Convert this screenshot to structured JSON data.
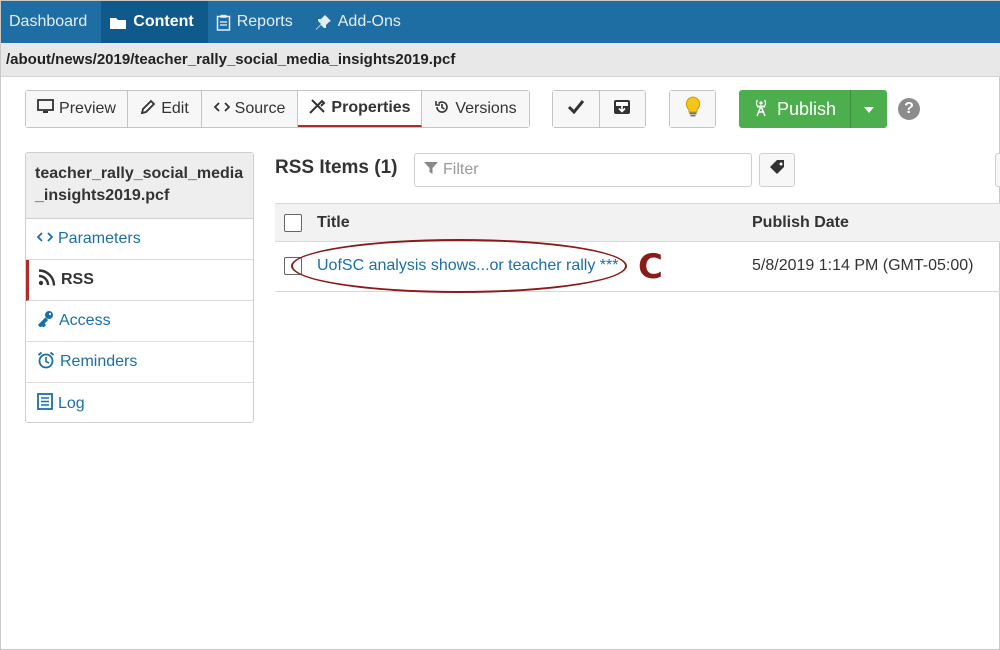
{
  "nav": {
    "items": [
      {
        "label": "Dashboard",
        "icon": ""
      },
      {
        "label": "Content",
        "icon": "folder-icon"
      },
      {
        "label": "Reports",
        "icon": "clipboard-icon"
      },
      {
        "label": "Add-Ons",
        "icon": "pin-icon"
      }
    ],
    "active": "Content"
  },
  "path": "/about/news/2019/teacher_rally_social_media_insights2019.pcf",
  "toolbar": {
    "view_buttons": [
      {
        "label": "Preview",
        "icon": "monitor-icon"
      },
      {
        "label": "Edit",
        "icon": "pencil-icon"
      },
      {
        "label": "Source",
        "icon": "code-icon"
      },
      {
        "label": "Properties",
        "icon": "tools-icon"
      },
      {
        "label": "Versions",
        "icon": "history-icon"
      }
    ],
    "active_view": "Properties",
    "publish_label": "Publish"
  },
  "sidebar": {
    "file_title": "teacher_rally_social_media_insights2019.pcf",
    "items": [
      {
        "label": "Parameters",
        "icon": "code-icon"
      },
      {
        "label": "RSS",
        "icon": "rss-icon"
      },
      {
        "label": "Access",
        "icon": "key-icon"
      },
      {
        "label": "Reminders",
        "icon": "alarm-icon"
      },
      {
        "label": "Log",
        "icon": "list-icon"
      }
    ],
    "active": "RSS"
  },
  "main": {
    "heading": "RSS Items (1)",
    "filter_placeholder": "Filter",
    "columns": {
      "title": "Title",
      "publish_date": "Publish Date"
    },
    "rows": [
      {
        "title": "UofSC analysis shows...or teacher rally ***",
        "publish_date": "5/8/2019 1:14 PM (GMT-05:00)"
      }
    ]
  },
  "annotation": {
    "letter": "C"
  },
  "colors": {
    "nav_bg": "#1f6ea3",
    "nav_active": "#0f5a8b",
    "publish_green": "#4cae4c",
    "link_blue": "#1a6fa8",
    "annotation_red": "#8b1a1a"
  }
}
